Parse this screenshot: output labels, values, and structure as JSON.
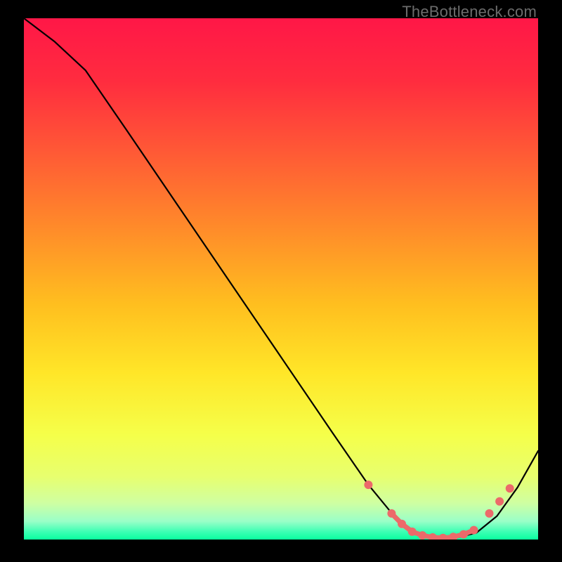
{
  "watermark": "TheBottleneck.com",
  "gradient_stops": [
    {
      "offset": 0.0,
      "color": "#ff1747"
    },
    {
      "offset": 0.12,
      "color": "#ff2c3f"
    },
    {
      "offset": 0.25,
      "color": "#ff5736"
    },
    {
      "offset": 0.4,
      "color": "#ff8a2a"
    },
    {
      "offset": 0.55,
      "color": "#ffbf1f"
    },
    {
      "offset": 0.68,
      "color": "#ffe628"
    },
    {
      "offset": 0.8,
      "color": "#f5ff4a"
    },
    {
      "offset": 0.88,
      "color": "#e7ff6f"
    },
    {
      "offset": 0.93,
      "color": "#cfffa2"
    },
    {
      "offset": 0.965,
      "color": "#9affc8"
    },
    {
      "offset": 0.985,
      "color": "#3dffb4"
    },
    {
      "offset": 1.0,
      "color": "#0aff9e"
    }
  ],
  "chart_data": {
    "type": "line",
    "x": [
      0.0,
      0.06,
      0.12,
      0.2,
      0.3,
      0.4,
      0.5,
      0.6,
      0.67,
      0.72,
      0.76,
      0.8,
      0.84,
      0.88,
      0.92,
      0.96,
      1.0
    ],
    "values": [
      1.0,
      0.955,
      0.9,
      0.785,
      0.64,
      0.495,
      0.35,
      0.205,
      0.105,
      0.045,
      0.015,
      0.003,
      0.003,
      0.013,
      0.045,
      0.1,
      0.17
    ],
    "xlim": [
      0,
      1
    ],
    "ylim": [
      0,
      1
    ],
    "title": "",
    "xlabel": "",
    "ylabel": "",
    "markers": {
      "x": [
        0.67,
        0.715,
        0.735,
        0.755,
        0.775,
        0.795,
        0.815,
        0.835,
        0.855,
        0.875,
        0.905,
        0.925,
        0.945
      ],
      "y": [
        0.105,
        0.05,
        0.03,
        0.015,
        0.008,
        0.004,
        0.003,
        0.005,
        0.01,
        0.018,
        0.05,
        0.073,
        0.098
      ]
    }
  }
}
